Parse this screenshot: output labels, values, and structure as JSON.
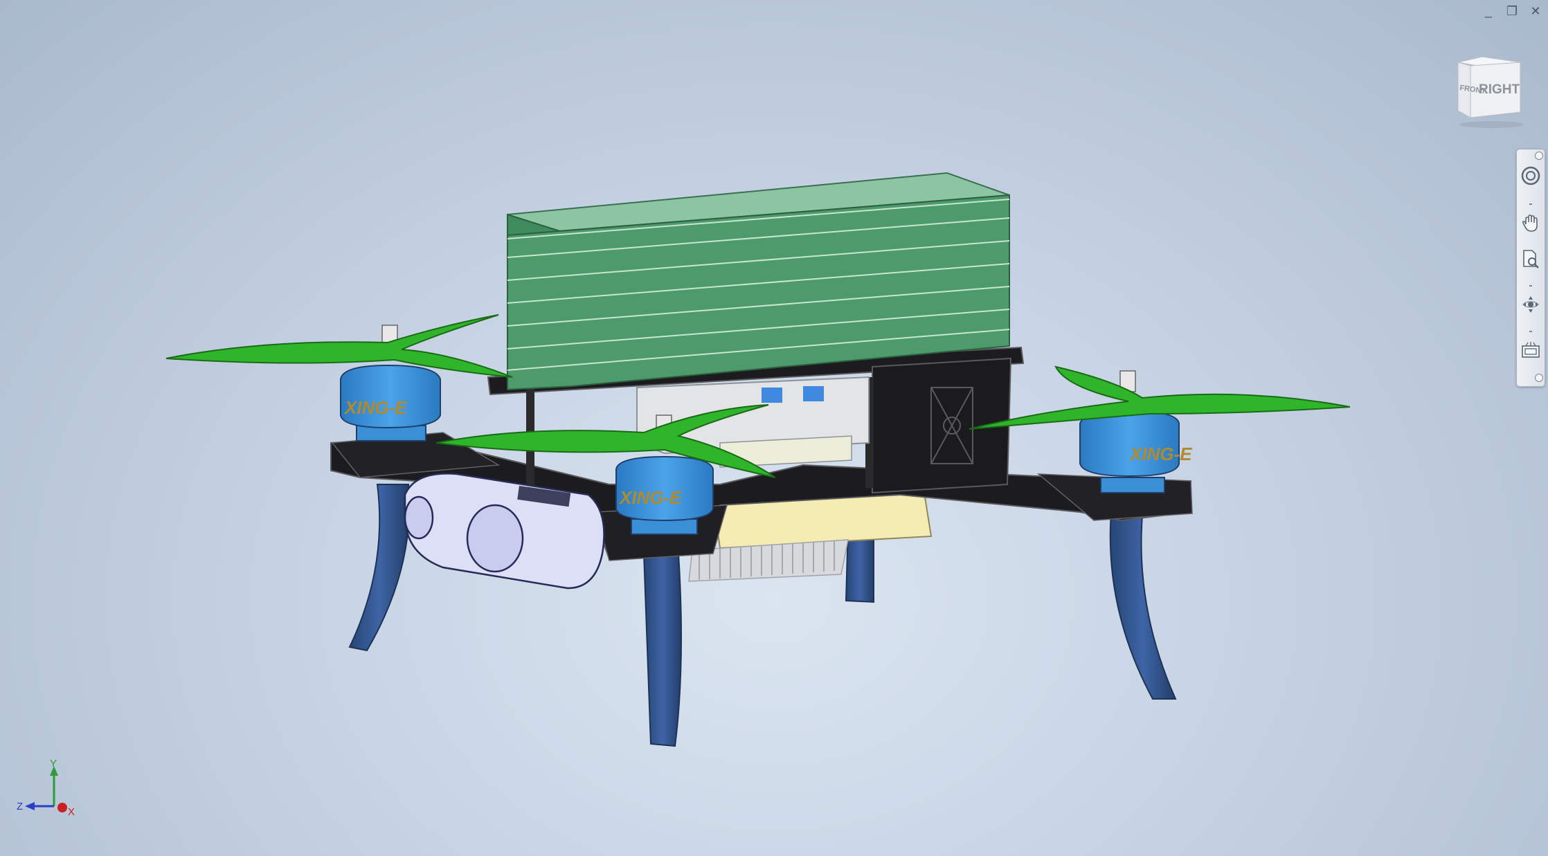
{
  "window_controls": {
    "minimize_glyph": "_",
    "restore_glyph": "❐",
    "close_glyph": "✕"
  },
  "viewcube": {
    "front_label": "FRONT",
    "right_label": "RIGHT"
  },
  "navigation_bar": {
    "tools": [
      "full-navigation-wheel",
      "pan",
      "zoom",
      "orbit",
      "look-at"
    ]
  },
  "axis_triad": {
    "y_label": "Y",
    "z_label": "Z",
    "x_label": "X",
    "colors": {
      "y": "#2e9a3a",
      "z": "#2a3fc4",
      "x": "#cc1f1f"
    }
  },
  "model": {
    "colors": {
      "battery_top": "#8cc5a2",
      "battery_side": "#4d9a6b",
      "battery_front": "#3f8b5e",
      "frame": "#1c1c1e",
      "props": "#2fb52a",
      "motors": "#3a8fd6",
      "legs": "#2f4f86",
      "camera": "#dcdff5",
      "board": "#f2eab0"
    },
    "motor_text": "XING-E"
  }
}
